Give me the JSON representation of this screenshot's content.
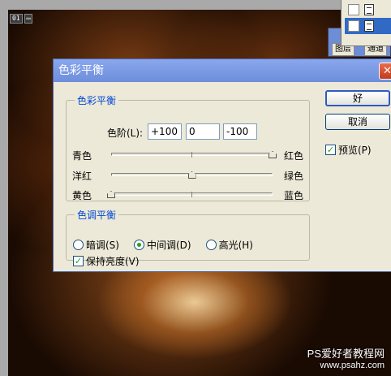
{
  "document": {
    "tab_number": "01",
    "tab_icon": "document-icon"
  },
  "layers_panel": {
    "tab1": "图层",
    "tab2": "通道"
  },
  "dialog": {
    "title": "色彩平衡",
    "color_balance": {
      "legend": "色彩平衡",
      "levels_label": "色阶(L):",
      "levels": [
        "+100",
        "0",
        "-100"
      ],
      "sliders": [
        {
          "left": "青色",
          "right": "红色",
          "value": 100
        },
        {
          "left": "洋红",
          "right": "绿色",
          "value": 0
        },
        {
          "left": "黄色",
          "right": "蓝色",
          "value": -100
        }
      ]
    },
    "tone_balance": {
      "legend": "色调平衡",
      "options": [
        {
          "label": "暗调(S)",
          "selected": false
        },
        {
          "label": "中间调(D)",
          "selected": true
        },
        {
          "label": "高光(H)",
          "selected": false
        }
      ],
      "preserve_luminosity": {
        "label": "保持亮度(V)",
        "checked": true
      }
    },
    "buttons": {
      "ok": "好",
      "cancel": "取消"
    },
    "preview": {
      "label": "预览(P)",
      "checked": true
    }
  },
  "watermark": {
    "line1": "PS爱好者教程网",
    "line2": "www.psahz.com"
  },
  "colors": {
    "titlebar": "#7a9ae3",
    "legend_text": "#0046d5",
    "dialog_bg": "#ece9d8",
    "check_green": "#21a121"
  }
}
